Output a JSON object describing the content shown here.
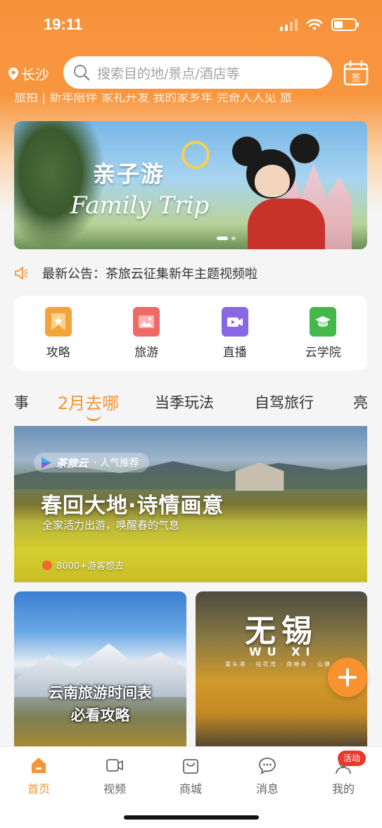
{
  "status_bar": {
    "time": "19:11"
  },
  "header": {
    "city": "长沙",
    "search_placeholder": "搜索目的地/景点/酒店等",
    "signin_label": "签",
    "ticker_text": "旅拍 | 新年陪伴 家礼开发 我的家乡年 完奇人人见 旅"
  },
  "banner": {
    "title_cn": "亲子游",
    "title_en": "Family Trip"
  },
  "notice": {
    "text": "最新公告：茶旅云征集新年主题视频啦"
  },
  "quick_links": [
    {
      "label": "攻略",
      "color": "#f2a43a"
    },
    {
      "label": "旅游",
      "color": "#ef6a66"
    },
    {
      "label": "直播",
      "color": "#8a67e6"
    },
    {
      "label": "云学院",
      "color": "#45b84a"
    }
  ],
  "tabs": [
    "事",
    "2月去哪",
    "当季玩法",
    "自驾旅行",
    "亮"
  ],
  "active_tab": "2月去哪",
  "feature": {
    "brand": "茶旅云",
    "tag": "· 人气推荐",
    "title": "春回大地·诗情画意",
    "subtitle": "全家活力出游，唤醒春的气息",
    "count": "8000+游客想去"
  },
  "cards": [
    {
      "line1": "云南旅游时间表",
      "line2": "必看攻略"
    },
    {
      "title": "无锡",
      "subtitle": "WU XI",
      "caption": "鼋头渚 · 拈花湾 · 南禅寺 · 山塘"
    }
  ],
  "tabbar": [
    {
      "label": "首页",
      "icon": "home-icon",
      "active": true
    },
    {
      "label": "视频",
      "icon": "video-icon",
      "active": false
    },
    {
      "label": "商城",
      "icon": "shop-bag-icon",
      "active": false
    },
    {
      "label": "消息",
      "icon": "message-icon",
      "active": false
    },
    {
      "label": "我的",
      "icon": "profile-icon",
      "active": false
    }
  ],
  "tabbar_badge": "活动",
  "colors": {
    "accent": "#f49637",
    "header": "#f7923b",
    "badge": "#e8392b"
  }
}
